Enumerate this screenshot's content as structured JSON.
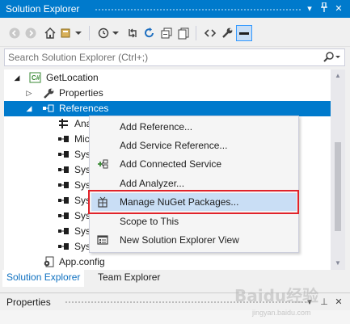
{
  "window": {
    "title": "Solution Explorer"
  },
  "toolbar": {
    "icons": [
      "back-icon",
      "forward-icon",
      "home-icon",
      "switch-views-icon",
      "history-icon",
      "sync-icon",
      "refresh-icon",
      "collapse-all-icon",
      "show-all-files-icon",
      "code-view-icon",
      "properties-wrench-icon",
      "preview-selected-icon"
    ]
  },
  "search": {
    "placeholder": "Search Solution Explorer (Ctrl+;)"
  },
  "tree": {
    "project": "GetLocation",
    "properties": "Properties",
    "references": "References",
    "refs": [
      "Ana",
      "Mic",
      "Sys",
      "Sys",
      "Sys",
      "Sys",
      "Sys",
      "Sys",
      "Sys"
    ],
    "appconfig": "App.config"
  },
  "context_menu": {
    "items": [
      {
        "label": "Add Reference..."
      },
      {
        "label": "Add Service Reference..."
      },
      {
        "label": "Add Connected Service"
      },
      {
        "label": "Add Analyzer..."
      },
      {
        "label": "Manage NuGet Packages..."
      },
      {
        "label": "Scope to This"
      },
      {
        "label": "New Solution Explorer View"
      }
    ]
  },
  "tabs": {
    "solution_explorer": "Solution Explorer",
    "team_explorer": "Team Explorer"
  },
  "properties_panel": {
    "title": "Properties"
  },
  "watermark": {
    "text": "Baidu经验",
    "sub": "jingyan.baidu.com"
  },
  "colors": {
    "accent": "#007acc",
    "highlight": "#c9def5",
    "callout": "#e1232a"
  }
}
